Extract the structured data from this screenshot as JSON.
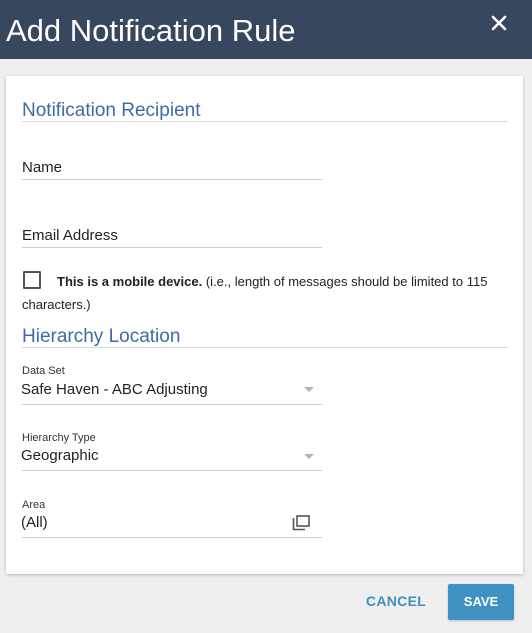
{
  "dialog": {
    "title": "Add Notification Rule",
    "close_icon": "close-icon"
  },
  "recipient": {
    "section_title": "Notification Recipient",
    "name_label": "Name",
    "email_label": "Email Address",
    "mobile_checked": false,
    "mobile_bold": "This is a mobile device.",
    "mobile_note": " (i.e., length of messages should be limited to 115 characters.)"
  },
  "hierarchy": {
    "section_title": "Hierarchy Location",
    "data_set_label": "Data Set",
    "data_set_value": "Safe Haven - ABC Adjusting",
    "hierarchy_type_label": "Hierarchy Type",
    "hierarchy_type_value": "Geographic",
    "area_label": "Area",
    "area_value": "(All)",
    "area_icon": "copy-icon"
  },
  "footer": {
    "cancel_label": "CANCEL",
    "save_label": "SAVE"
  },
  "colors": {
    "header_bg": "#37475e",
    "section_title": "#3f6aa6",
    "save_bg": "#3e92c3",
    "cancel_text": "#3f8fbf"
  }
}
